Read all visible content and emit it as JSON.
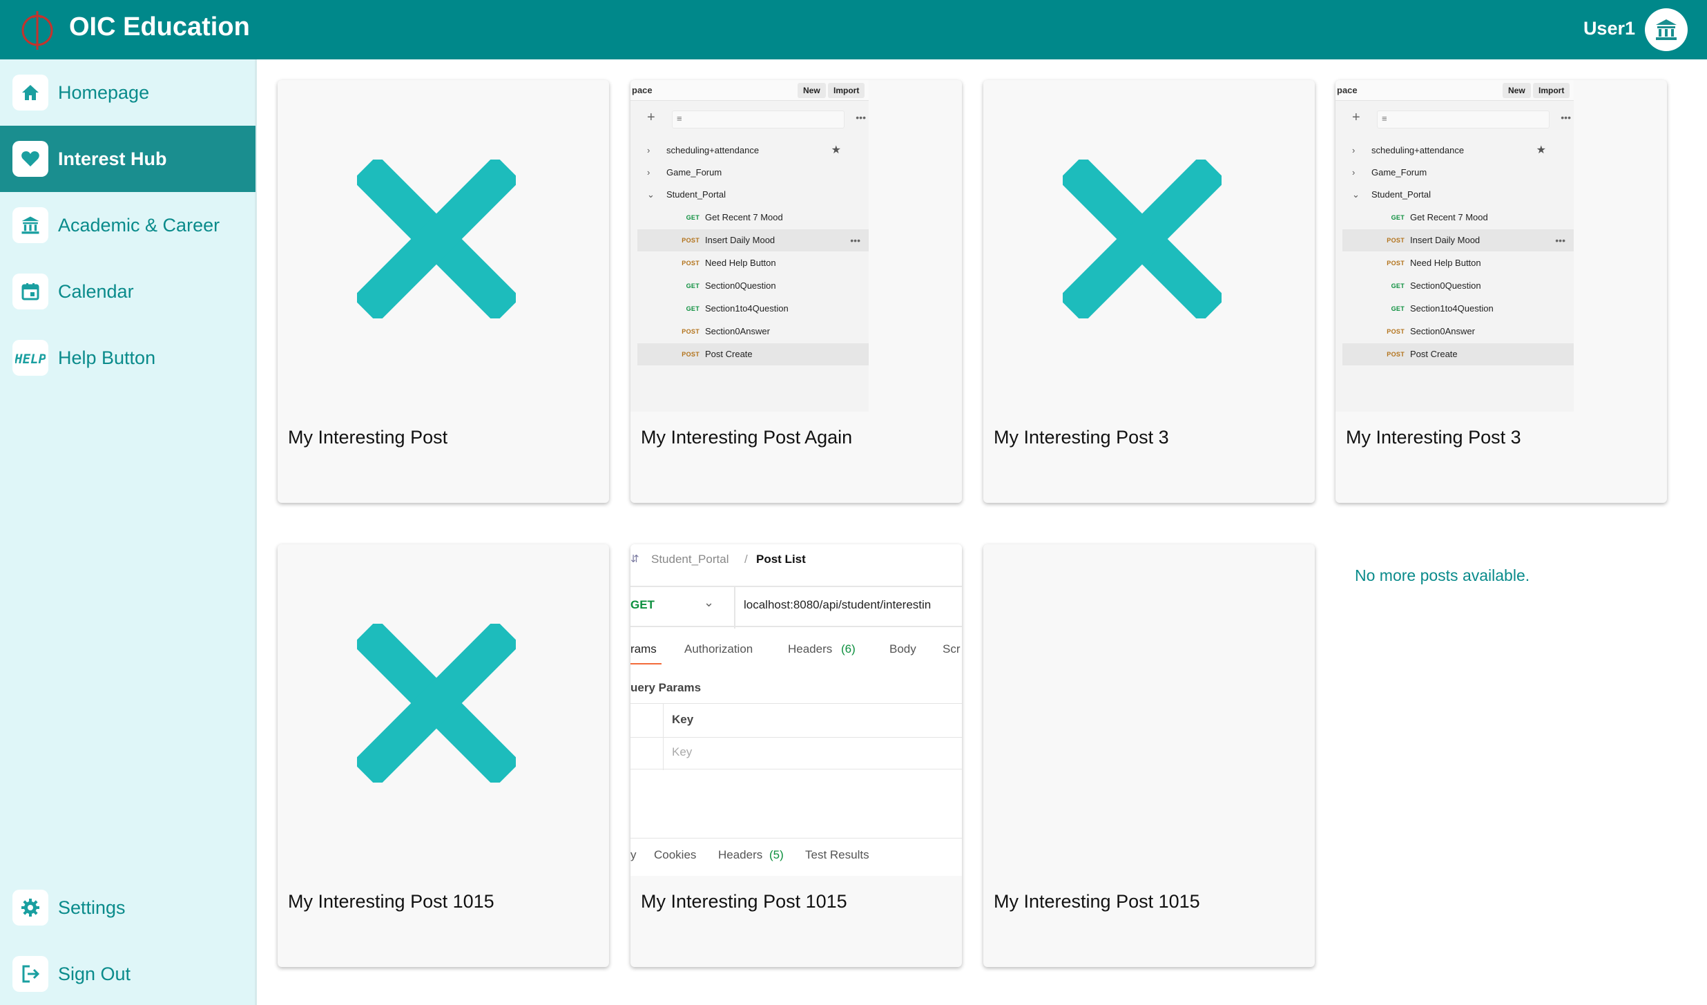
{
  "header": {
    "title": "OIC Education",
    "user_name": "User1"
  },
  "sidebar": {
    "items": [
      {
        "label": "Homepage",
        "icon": "home-icon"
      },
      {
        "label": "Interest Hub",
        "icon": "heart-icon",
        "active": true
      },
      {
        "label": "Academic & Career",
        "icon": "institution-icon"
      },
      {
        "label": "Calendar",
        "icon": "calendar-icon"
      },
      {
        "label": "Help Button",
        "icon": "help-icon"
      }
    ],
    "bottom_items": [
      {
        "label": "Settings",
        "icon": "gear-icon"
      },
      {
        "label": "Sign Out",
        "icon": "sign-out-icon"
      }
    ]
  },
  "posts": [
    {
      "title": "My Interesting Post",
      "thumbnail": "broken-image-x-icon"
    },
    {
      "title": "My Interesting Post Again",
      "thumbnail": "postman-collection-screenshot"
    },
    {
      "title": "My Interesting Post 3",
      "thumbnail": "broken-image-x-icon"
    },
    {
      "title": "My Interesting Post 3",
      "thumbnail": "postman-collection-screenshot"
    },
    {
      "title": "My Interesting Post 1015",
      "thumbnail": "broken-image-x-icon"
    },
    {
      "title": "My Interesting Post 1015",
      "thumbnail": "postman-request-screenshot"
    },
    {
      "title": "My Interesting Post 1015",
      "thumbnail": "blank"
    }
  ],
  "postman_collection": {
    "workspace": "pace",
    "new_label": "New",
    "import_label": "Import",
    "collections": [
      "scheduling+attendance",
      "Game_Forum",
      "Student_Portal"
    ],
    "requests": [
      {
        "method": "GET",
        "name": "Get Recent 7 Mood"
      },
      {
        "method": "POST",
        "name": "Insert Daily Mood"
      },
      {
        "method": "POST",
        "name": "Need Help Button"
      },
      {
        "method": "GET",
        "name": "Section0Question"
      },
      {
        "method": "GET",
        "name": "Section1to4Question"
      },
      {
        "method": "POST",
        "name": "Section0Answer"
      },
      {
        "method": "POST",
        "name": "Post Create"
      }
    ]
  },
  "postman_request": {
    "crumb_parent": "Student_Portal",
    "crumb_sep": "/",
    "crumb_current": "Post List",
    "method": "GET",
    "url": "localhost:8080/api/student/interestin",
    "tabs": [
      "rams",
      "Authorization",
      "Headers",
      "Body",
      "Scr"
    ],
    "headers_count": "(6)",
    "query_params_label": "uery Params",
    "key_header": "Key",
    "key_placeholder": "Key",
    "response_tabs": [
      "y",
      "Cookies",
      "Headers",
      "Test Results"
    ],
    "response_headers_count": "(5)"
  },
  "empty_message": "No more posts available.",
  "colors": {
    "brand": "#00888a",
    "sidebar_bg": "#dff6f8",
    "accent_text": "#0a8b8b",
    "x_mark": "#1dbcbc"
  }
}
